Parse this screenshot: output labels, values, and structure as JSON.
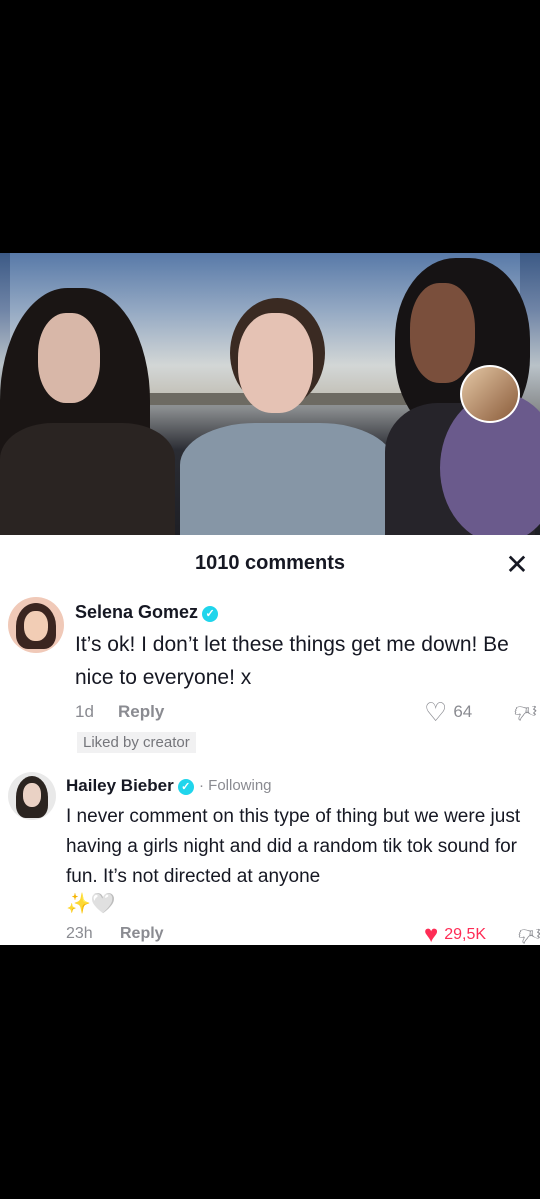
{
  "comments_panel": {
    "title": "1010 comments",
    "close_label": "✕",
    "comments": [
      {
        "author": "Selena Gomez",
        "verified": true,
        "text": "It’s ok! I don’t let these things get me down! Be nice to everyone! x",
        "time": "1d",
        "reply_label": "Reply",
        "likes": "64",
        "liked": false,
        "badge": "Liked by creator"
      },
      {
        "author": "Hailey Bieber",
        "verified": true,
        "following": "· Following",
        "text": "I never comment on this type of thing but we were just having a girls night and did a random tik tok sound for fun. It’s not directed at anyone",
        "emoji": "✨🤍",
        "time": "23h",
        "reply_label": "Reply",
        "likes": "29,5K",
        "liked": true
      }
    ]
  },
  "icons": {
    "close": "close-icon",
    "verified": "verified-badge-icon",
    "like_outline": "heart-outline-icon",
    "like_filled": "heart-filled-icon",
    "dislike": "dislike-icon"
  },
  "colors": {
    "background": "#000000",
    "panel": "#ffffff",
    "text": "#161823",
    "muted": "#8a8b91",
    "like_red": "#fe2c55",
    "verified": "#20d5ec"
  }
}
